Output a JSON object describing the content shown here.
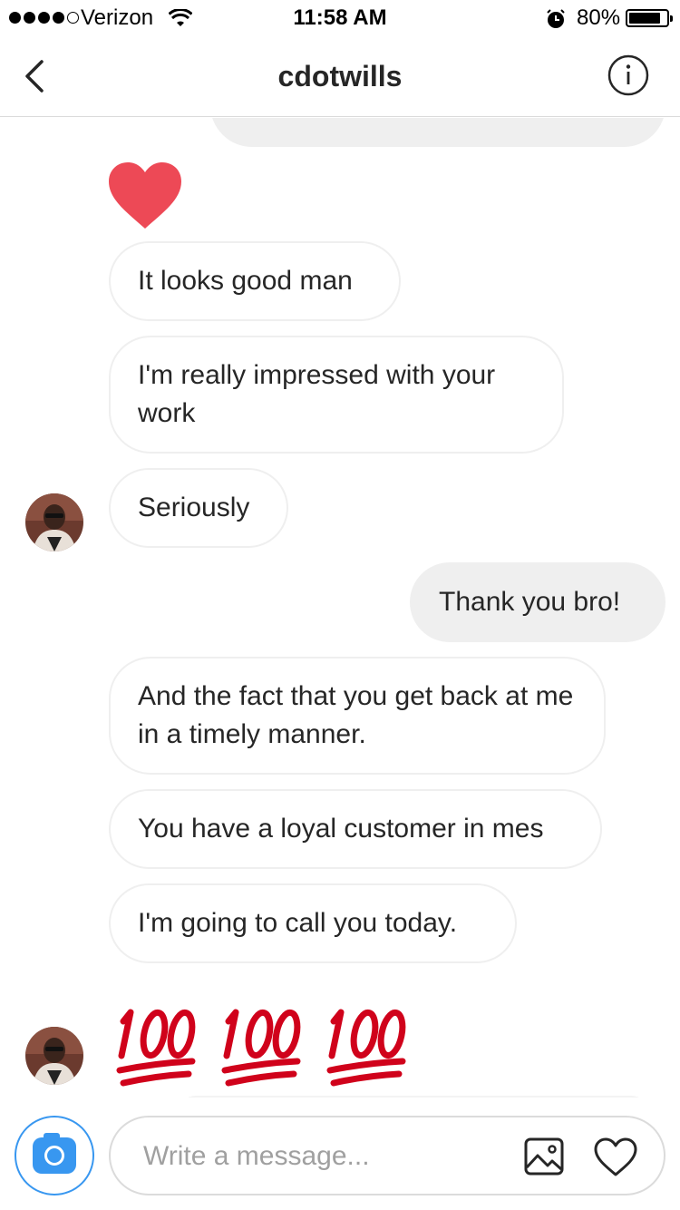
{
  "status_bar": {
    "carrier": "Verizon",
    "time": "11:58 AM",
    "battery": "80%",
    "battery_level": 0.8
  },
  "header": {
    "title": "cdotwills"
  },
  "messages": [
    {
      "type": "heart-emoji",
      "from": "them"
    },
    {
      "text": "It looks good man",
      "from": "them"
    },
    {
      "text": "I'm really impressed with your work",
      "from": "them"
    },
    {
      "text": "Seriously",
      "from": "them"
    },
    {
      "text": "Thank you bro!",
      "from": "me"
    },
    {
      "text": "And the fact that you get back at me in a timely manner.",
      "from": "them"
    },
    {
      "text": "You have a loyal customer in mes",
      "from": "them"
    },
    {
      "text": "I'm going to call you today.",
      "from": "them"
    },
    {
      "type": "hundred-emoji",
      "count": 3,
      "from": "them"
    }
  ],
  "composer": {
    "placeholder": "Write a message..."
  },
  "icons": {
    "back": "chevron-left-icon",
    "info": "info-icon",
    "camera": "camera-icon",
    "gallery": "gallery-icon",
    "like": "heart-icon"
  },
  "colors": {
    "accent": "#3897f0",
    "heart_red": "#ed4956",
    "hundred_red": "#d0021b",
    "outgoing_bubble": "#efefef"
  }
}
